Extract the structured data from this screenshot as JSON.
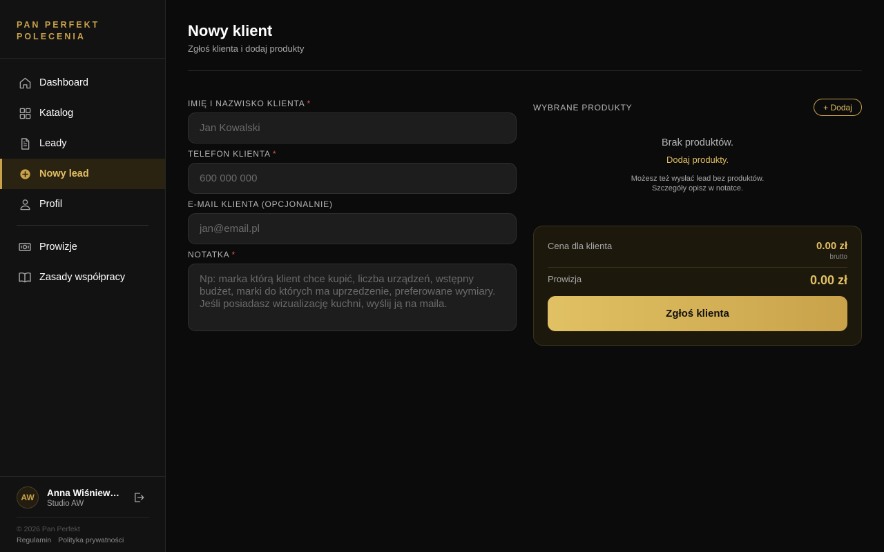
{
  "brand": {
    "line1": "PAN PERFEKT",
    "line2": "POLECENIA"
  },
  "sidebar": {
    "items": [
      {
        "label": "Dashboard",
        "icon": "home-icon"
      },
      {
        "label": "Katalog",
        "icon": "grid-icon"
      },
      {
        "label": "Leady",
        "icon": "document-icon"
      },
      {
        "label": "Nowy lead",
        "icon": "plus-circle-icon",
        "active": true
      },
      {
        "label": "Profil",
        "icon": "user-icon"
      }
    ],
    "secondary": [
      {
        "label": "Prowizje",
        "icon": "money-icon"
      },
      {
        "label": "Zasady współpracy",
        "icon": "book-icon"
      }
    ]
  },
  "user": {
    "initials": "AW",
    "name": "Anna Wiśniewska",
    "company": "Studio AW"
  },
  "footer": {
    "copyright": "© 2026 Pan Perfekt",
    "terms": "Regulamin",
    "privacy": "Polityka prywatności"
  },
  "page": {
    "title": "Nowy klient",
    "subtitle": "Zgłoś klienta i dodaj produkty"
  },
  "form": {
    "name": {
      "label": "IMIĘ I NAZWISKO KLIENTA",
      "required": "*",
      "placeholder": "Jan Kowalski",
      "value": ""
    },
    "phone": {
      "label": "TELEFON KLIENTA",
      "required": "*",
      "placeholder": "600 000 000",
      "value": ""
    },
    "email": {
      "label": "E-MAIL KLIENTA (OPCJONALNIE)",
      "placeholder": "jan@email.pl",
      "value": ""
    },
    "note": {
      "label": "NOTATKA",
      "required": "*",
      "placeholder": "Np: marka którą klient chce kupić, liczba urządzeń, wstępny budżet, marki do których ma uprzedzenie, preferowane wymiary. Jeśli posiadasz wizualizację kuchni, wyślij ją na maila.",
      "value": ""
    }
  },
  "products": {
    "label": "WYBRANE PRODUKTY",
    "add_label": "+ Dodaj",
    "empty_title": "Brak produktów.",
    "empty_link": "Dodaj produkty.",
    "empty_note_line1": "Możesz też wysłać lead bez produktów.",
    "empty_note_line2": "Szczegóły opisz w notatce."
  },
  "summary": {
    "price_label": "Cena dla klienta",
    "price_value": "0.00 zł",
    "price_sub": "brutto",
    "commission_label": "Prowizja",
    "commission_value": "0.00 zł",
    "submit_label": "Zgłoś klienta"
  },
  "colors": {
    "accent": "#c9a24a",
    "accent_light": "#e2bf63",
    "background": "#0b0b0b",
    "sidebar": "#121212",
    "required": "#e05555"
  }
}
